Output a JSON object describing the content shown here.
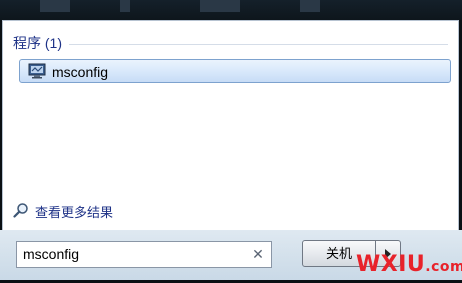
{
  "results": {
    "group_header": "程序 (1)",
    "items": [
      {
        "label": "msconfig",
        "icon": "system-configuration-icon"
      }
    ]
  },
  "see_more": {
    "label": "查看更多结果",
    "icon": "magnifier-icon"
  },
  "search": {
    "value": "msconfig",
    "clear_icon": "clear-x-icon"
  },
  "power": {
    "shutdown_label": "关机",
    "arrow_icon": "arrow-right-icon"
  },
  "watermark": {
    "text": "WXIU",
    "suffix": ".com",
    "color": "#e8222a"
  },
  "colors": {
    "header": "#1e3287",
    "selection_border": "#7da2ce",
    "background": "#0a1014"
  }
}
